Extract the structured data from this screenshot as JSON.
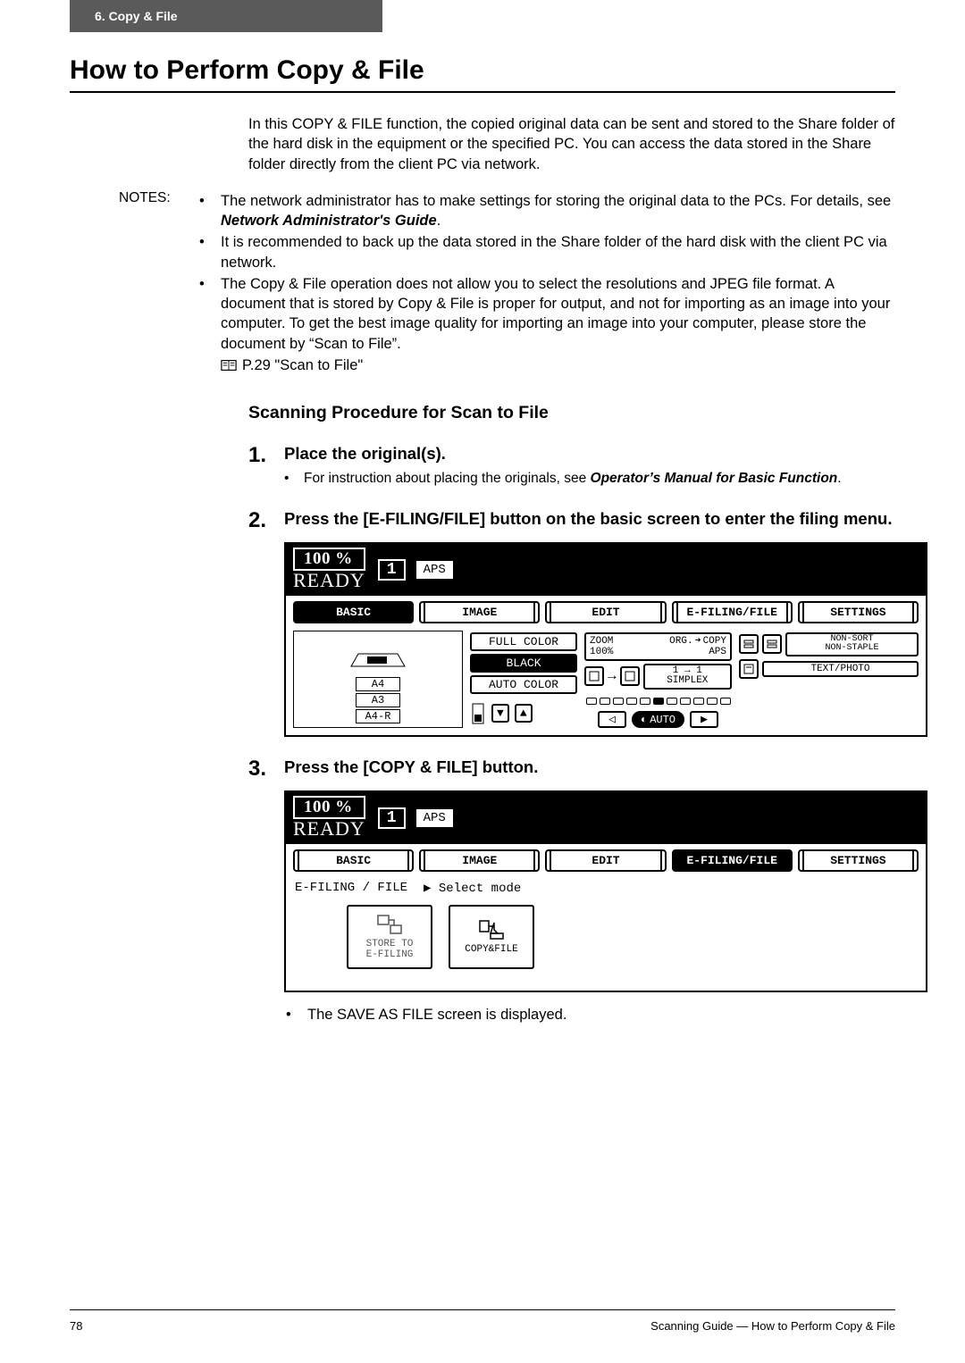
{
  "header": {
    "tab": "6.  Copy & File"
  },
  "title": "How to Perform Copy & File",
  "intro": "In this COPY & FILE function, the copied original data can be sent and stored to the Share folder of the hard disk in the equipment or the specified PC. You can access the data stored in the Share folder directly from the client PC via network.",
  "notes_label": "NOTES:",
  "notes": [
    {
      "pre": "The network administrator has to make settings for storing the original data to the PCs. For details, see ",
      "em": "Network Administrator's Guide",
      "post": "."
    },
    {
      "pre": "It is recommended to back up the data stored in the Share folder of the hard disk with the client PC via network."
    },
    {
      "pre": "The Copy & File operation does not allow you to select the resolutions and JPEG file format.  A document that is stored by Copy & File is proper for output, and not for importing as an image into your computer.  To get the best image quality for importing an image into your computer, please store the document by “Scan to File”.",
      "ref": "P.29 \"Scan to File\""
    }
  ],
  "subhead": "Scanning Procedure for Scan to File",
  "steps": [
    {
      "num": "1.",
      "title": "Place the original(s).",
      "sub_pre": "For instruction about placing the originals, see ",
      "sub_em": "Operator’s Manual for Basic Function",
      "sub_post": "."
    },
    {
      "num": "2.",
      "title": "Press the [E-FILING/FILE] button on the basic screen to enter the filing menu."
    },
    {
      "num": "3.",
      "title": "Press the [COPY & FILE] button."
    }
  ],
  "lcd": {
    "percent": "100  %",
    "ready": "READY",
    "count": "1",
    "aps": "APS",
    "tabs": [
      "BASIC",
      "IMAGE",
      "EDIT",
      "E-FILING/FILE",
      "SETTINGS"
    ],
    "panel1": {
      "active_tab": 0,
      "papers": [
        "A4",
        "A3",
        "A4-R"
      ],
      "color_btns": [
        "FULL COLOR",
        "BLACK",
        "AUTO COLOR"
      ],
      "zoom": {
        "label1": "ZOOM",
        "label2": "100%",
        "label3": "ORG. ➜ COPY",
        "label4": "APS"
      },
      "simplex": {
        "label1": "1 → 1",
        "label2": "SIMPLEX"
      },
      "sort": "NON-SORT\nNON-STAPLE",
      "mode": "TEXT/PHOTO",
      "auto": "AUTO"
    },
    "panel2": {
      "active_tab": 3,
      "crumb": "E-FILING / FILE",
      "crumb2": "▶ Select mode",
      "btns": [
        "STORE TO\nE-FILING",
        "COPY&FILE"
      ]
    }
  },
  "post_note": "The SAVE AS FILE screen is displayed.",
  "footer": {
    "page": "78",
    "right": "Scanning Guide — How to Perform Copy & File"
  }
}
